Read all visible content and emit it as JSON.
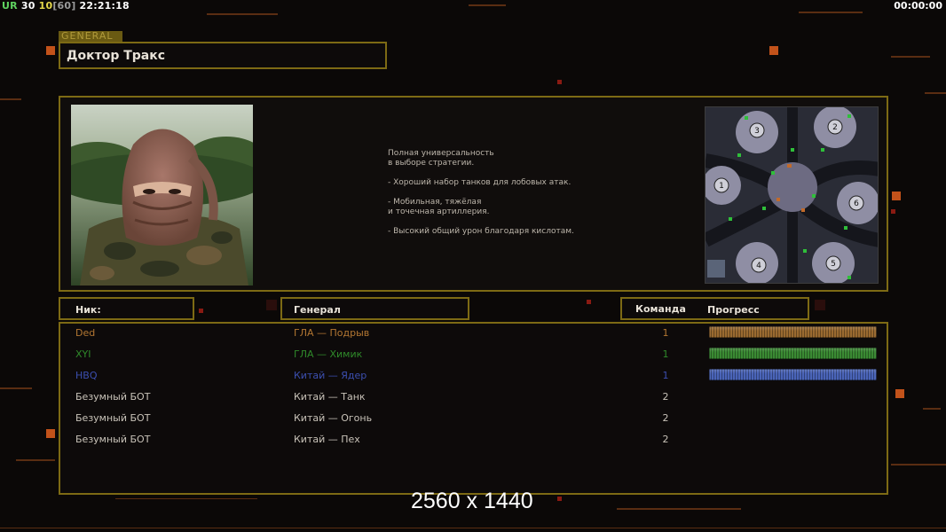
{
  "hud": {
    "ur_label": "UR",
    "ur_value": "30",
    "fps": "10",
    "fps_cap": "[60]",
    "clock": "22:21:18",
    "timer": "00:00:00"
  },
  "header": {
    "tag": "GENERAL",
    "title": "Доктор Тракс"
  },
  "general_info": {
    "description": "Полная универсальность\nв выборе стратегии.\n\n- Хороший набор танков для лобовых атак.\n\n- Мобильная, тяжёлая\nи точечная артиллерия.\n\n- Высокий общий урон благодаря кислотам."
  },
  "minimap": {
    "start_positions": [
      "1",
      "2",
      "3",
      "4",
      "5",
      "6"
    ]
  },
  "columns": {
    "nick": "Ник:",
    "general": "Генерал",
    "team": "Команда",
    "progress": "Прогресс"
  },
  "players": [
    {
      "nick": "Ded",
      "general": "ГЛА — Подрыв",
      "team": "1",
      "color": "#b37732",
      "progress": 1.0,
      "bar_color": "#9a6a30"
    },
    {
      "nick": "XYI",
      "general": "ГЛА — Химик",
      "team": "1",
      "color": "#2f8a2a",
      "progress": 1.0,
      "bar_color": "#3a8a33"
    },
    {
      "nick": "HBQ",
      "general": "Китай — Ядер",
      "team": "1",
      "color": "#3c4fb0",
      "progress": 1.0,
      "bar_color": "#4a64b8"
    },
    {
      "nick": "Безумный БОТ",
      "general": "Китай — Танк",
      "team": "2",
      "color": "#c8c2b8"
    },
    {
      "nick": "Безумный БОТ",
      "general": "Китай — Огонь",
      "team": "2",
      "color": "#c8c2b8"
    },
    {
      "nick": "Безумный БОТ",
      "general": "Китай — Пех",
      "team": "2",
      "color": "#c8c2b8"
    }
  ],
  "watermark": "2560 x 1440"
}
